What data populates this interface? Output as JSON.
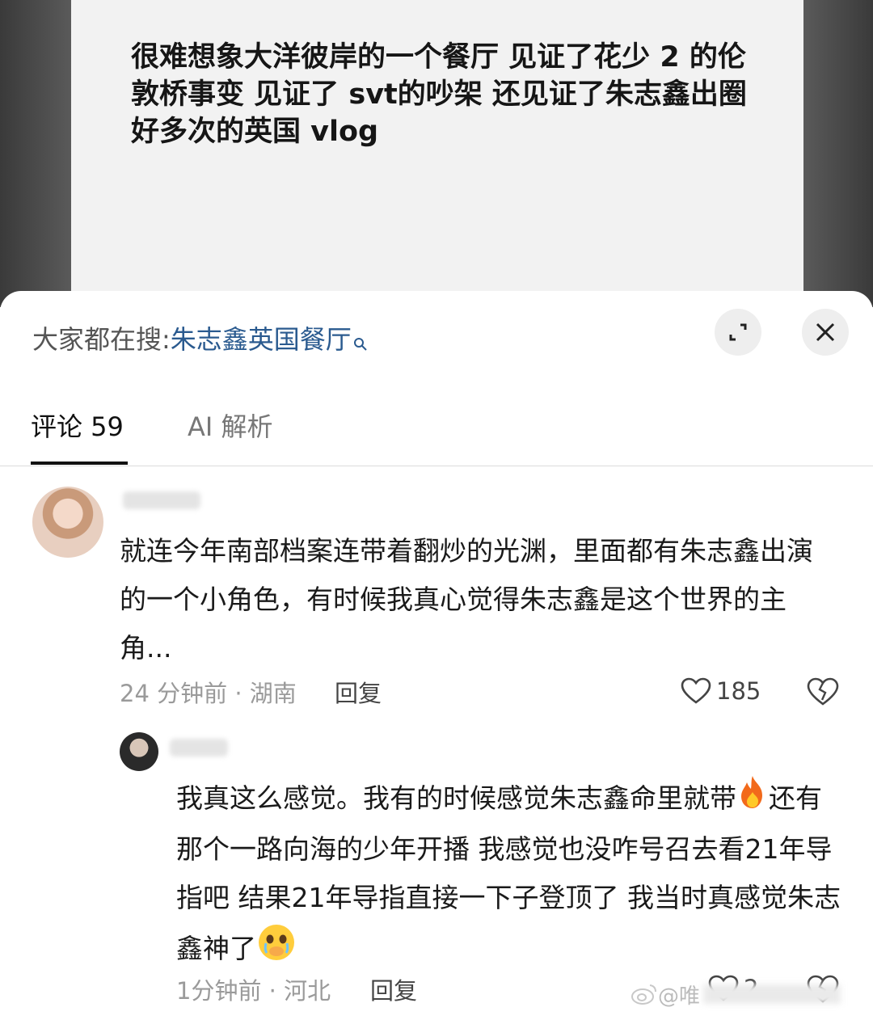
{
  "post": {
    "text": "很难想象大洋彼岸的一个餐厅 见证了花少 2 的伦敦桥事变 见证了 svt的吵架 还见证了朱志鑫出圈好多次的英国 vlog"
  },
  "search": {
    "prefix": "大家都在搜:",
    "query": "朱志鑫英国餐厅"
  },
  "tabs": [
    {
      "label": "评论 59",
      "active": true
    },
    {
      "label": "AI 解析",
      "active": false
    }
  ],
  "comments": [
    {
      "text": "就连今年南部档案连带着翻炒的光渊，里面都有朱志鑫出演的一个小角色，有时候我真心觉得朱志鑫是这个世界的主角...",
      "meta": "24 分钟前 · 湖南",
      "reply_label": "回复",
      "likes": "185"
    },
    {
      "text": "我真这么感觉。我有的时候感觉朱志鑫命里就带",
      "text_2": "还有那个一路向海的少年开播 我感觉也没咋号召去看21年导指吧 结果21年导指直接一下子登顶了 我当时真感觉朱志鑫神了",
      "meta": "1分钟前 · 河北",
      "reply_label": "回复",
      "likes": "2"
    }
  ],
  "watermark": {
    "text": "@唯"
  },
  "icons": {
    "search": "search-icon",
    "expand": "expand-icon",
    "close": "close-icon",
    "like": "heart-icon",
    "dislike": "broken-heart-icon",
    "fire": "fire-emoji",
    "teary": "teary-face-emoji",
    "weibo": "weibo-logo-icon"
  },
  "colors": {
    "link": "#2a5a8f",
    "muted": "#9a9a9a",
    "tab_underline": "#111111"
  }
}
